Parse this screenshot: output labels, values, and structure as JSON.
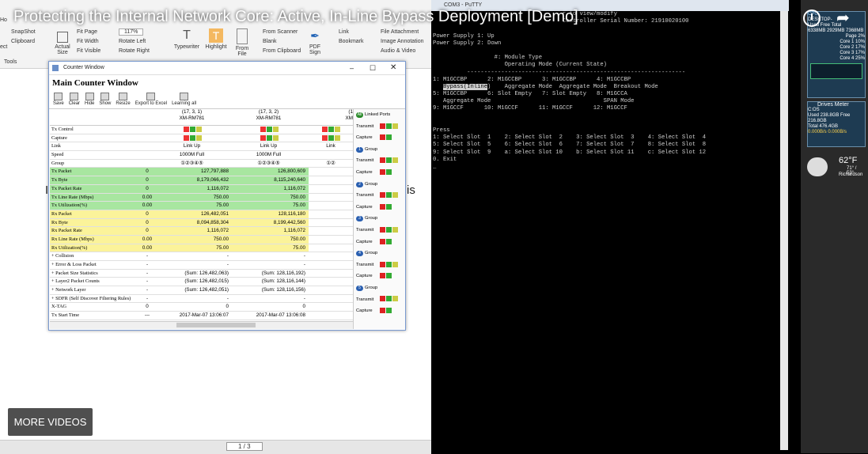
{
  "video": {
    "title": "Protecting the Internal Network Core: Active, In-Line Bypass Deployment [Demo]",
    "more_videos": "MORE VIDEOS"
  },
  "pdf_ribbon": {
    "left_items": [
      "SnapShot",
      "Clipboard"
    ],
    "left_labels": [
      "ect",
      "Ho",
      "Tools",
      "art"
    ],
    "actual_size": "Actual Size",
    "fit_page": "Fit Page",
    "fit_width": "Fit Width",
    "fit_visible": "Fit Visible",
    "zoom": "117%",
    "rotate_left": "Rotate Left",
    "rotate_right": "Rotate Right",
    "typewriter": "Typewriter",
    "highlight": "Highlight",
    "from_file": "From File",
    "from_scanner": "From Scanner",
    "blank": "Blank",
    "from_clipboard": "From Clipboard",
    "pdf_sign": "PDF Sign",
    "link": "Link",
    "bookmark": "Bookmark",
    "file_attachment": "File Attachment",
    "image_annotation": "Image Annotation",
    "audio_video": "Audio & Video"
  },
  "pdf_body_fragments": [
    "is",
    "I"
  ],
  "pdf_status": {
    "page": "1 / 3"
  },
  "counter_window": {
    "window_title": "Counter Window",
    "heading": "Main Counter Window",
    "toolbar": [
      "Save",
      "Clear",
      "Hide",
      "Show",
      "Resize",
      "Export to Excel",
      "Learning all"
    ],
    "columns": [
      {
        "line1": "(17, 3, 1)",
        "line2": "XM-RM781"
      },
      {
        "line1": "(17, 3, 2)",
        "line2": "XM-RM781"
      },
      {
        "line1": "(1",
        "line2": "XM"
      }
    ],
    "rows": [
      {
        "label": "Tx Control",
        "a": "",
        "b": "",
        "c": "",
        "bg": ""
      },
      {
        "label": "Capture",
        "a": "",
        "b": "",
        "c": "",
        "bg": ""
      },
      {
        "label": "Link",
        "z": "",
        "a": "Link Up",
        "b": "Link Up",
        "c": "Link",
        "bg": ""
      },
      {
        "label": "Speed",
        "z": "",
        "a": "1000M Full",
        "b": "1000M Full",
        "c": "",
        "bg": ""
      },
      {
        "label": "Group",
        "z": "",
        "a": "①②③④⑤",
        "b": "①②③④⑤",
        "c": "①②",
        "bg": ""
      },
      {
        "label": "Tx Packet",
        "z": "0",
        "a": "127,797,888",
        "b": "126,800,609",
        "c": "",
        "bg": "green"
      },
      {
        "label": "Tx Byte",
        "z": "0",
        "a": "8,179,066,432",
        "b": "8,115,240,640",
        "c": "",
        "bg": "green"
      },
      {
        "label": "Tx Packet Rate",
        "z": "0",
        "a": "1,116,072",
        "b": "1,116,072",
        "c": "",
        "bg": "green"
      },
      {
        "label": "Tx Line Rate (Mbps)",
        "z": "0.00",
        "a": "750.00",
        "b": "750.00",
        "c": "",
        "bg": "green"
      },
      {
        "label": "Tx Utilization(%)",
        "z": "0.00",
        "a": "75.00",
        "b": "75.00",
        "c": "",
        "bg": "green"
      },
      {
        "label": "Rx Packet",
        "z": "0",
        "a": "126,482,051",
        "b": "128,116,180",
        "c": "",
        "bg": "yellow"
      },
      {
        "label": "Rx Byte",
        "z": "0",
        "a": "8,094,858,304",
        "b": "8,199,442,560",
        "c": "",
        "bg": "yellow"
      },
      {
        "label": "Rx Packet Rate",
        "z": "0",
        "a": "1,116,072",
        "b": "1,116,072",
        "c": "",
        "bg": "yellow"
      },
      {
        "label": "Rx Line Rate (Mbps)",
        "z": "0.00",
        "a": "750.00",
        "b": "750.00",
        "c": "",
        "bg": "yellow"
      },
      {
        "label": "Rx Utilization(%)",
        "z": "0.00",
        "a": "75.00",
        "b": "75.00",
        "c": "",
        "bg": "yellow"
      },
      {
        "label": "+ Collision",
        "z": "-",
        "a": "-",
        "b": "-",
        "c": "",
        "bg": ""
      },
      {
        "label": "+ Error & Loss Packet",
        "z": "-",
        "a": "-",
        "b": "-",
        "c": "",
        "bg": ""
      },
      {
        "label": "+ Packet Size Statistics",
        "z": "-",
        "a": "(Sum: 126,482,063)",
        "b": "(Sum: 128,116,192)",
        "c": "",
        "bg": ""
      },
      {
        "label": "+ Layer2 Packet Counts",
        "z": "-",
        "a": "(Sum: 126,482,015)",
        "b": "(Sum: 128,116,144)",
        "c": "",
        "bg": ""
      },
      {
        "label": "+ Network Layer",
        "z": "-",
        "a": "(Sum: 126,482,051)",
        "b": "(Sum: 128,116,156)",
        "c": "",
        "bg": ""
      },
      {
        "label": "+ SDFR (Self Discover Filtering Rules)",
        "z": "-",
        "a": "-",
        "b": "-",
        "c": "",
        "bg": ""
      },
      {
        "label": "X-TAG",
        "z": "0",
        "a": "0",
        "b": "0",
        "c": "",
        "bg": ""
      },
      {
        "label": "Tx Start Time",
        "z": "---",
        "a": "2017-Mar-07 13:06:07",
        "b": "2017-Mar-07 13:06:08",
        "c": "",
        "bg": ""
      },
      {
        "label": "Tx End Time",
        "z": "---",
        "a": "---",
        "b": "---",
        "c": "",
        "bg": ""
      }
    ],
    "side_panel": [
      {
        "tag": "All",
        "text": "Linked Ports"
      },
      {
        "tag": "",
        "text": "Transmit"
      },
      {
        "tag": "",
        "text": "Capture"
      },
      {
        "tag": "1",
        "text": "Group"
      },
      {
        "tag": "",
        "text": "Transmit"
      },
      {
        "tag": "",
        "text": "Capture"
      },
      {
        "tag": "2",
        "text": "Group"
      },
      {
        "tag": "",
        "text": "Transmit"
      },
      {
        "tag": "",
        "text": "Capture"
      },
      {
        "tag": "3",
        "text": "Group"
      },
      {
        "tag": "",
        "text": "Transmit"
      },
      {
        "tag": "",
        "text": "Capture"
      },
      {
        "tag": "4",
        "text": "Group"
      },
      {
        "tag": "",
        "text": "Transmit"
      },
      {
        "tag": "",
        "text": "Capture"
      },
      {
        "tag": "5",
        "text": "Group"
      },
      {
        "tag": "",
        "text": "Transmit"
      },
      {
        "tag": "",
        "text": "Capture"
      }
    ]
  },
  "putty": {
    "title": "COM3 - PuTTY",
    "lines": [
      "                                      r to view/modify",
      "                                      Controller Serial Number: 21910020100",
      "",
      "Power Supply 1: Up",
      "Power Supply 2: Down",
      "",
      "                  #: Module Type",
      "                     Operating Mode (Current State)",
      "          ----------------------------------------------------------------",
      "1: M1GCCBP      2: M1GCCBP      3: M1GCCBP      4: M1GCCBP",
      "   [[Bypass(Inline]])    Aggregate Mode  Aggregate Mode  Breakout Mode",
      "5: M1GCCBP      6: Slot Empty   7: Slot Empty   8: M1GCCA",
      "   Aggregate Mode                                 SPAN Mode",
      "9: M1GCCF      10: M1GCCF      11: M1GCCF      12: M1GCCF",
      "",
      "",
      "Press",
      "1: Select Slot  1    2: Select Slot  2    3: Select Slot  3    4: Select Slot  4",
      "5: Select Slot  5    6: Select Slot  6    7: Select Slot  7    8: Select Slot  8",
      "9: Select Slot  9    a: Select Slot 10    b: Select Slot 11    c: Select Slot 12",
      "0. Exit",
      "_"
    ]
  },
  "gadgets": {
    "cpu_label": "CPU",
    "desktop": "DESKTOP-",
    "mem_rows": [
      "Used   Free   Total",
      "6338MB 2929MB 7368MB"
    ],
    "cores": [
      "Page  2%",
      "Core 1 10%",
      "Core 2 17%",
      "Core 3 17%",
      "Core 4 25%"
    ],
    "drives_title": "Drives Meter",
    "drives_lines": [
      "C:OS",
      "Used 238.8GB  Free 216.8GB",
      "Total 476.4GB",
      "0.000B/s   0.000B/s"
    ],
    "temp": "62°F",
    "temp_range": "71° / 53°",
    "city": "Richardson"
  },
  "colors": {
    "green_rows": "#a8e6a0",
    "yellow_rows": "#fbf39a",
    "terminal_bg": "#000000"
  }
}
